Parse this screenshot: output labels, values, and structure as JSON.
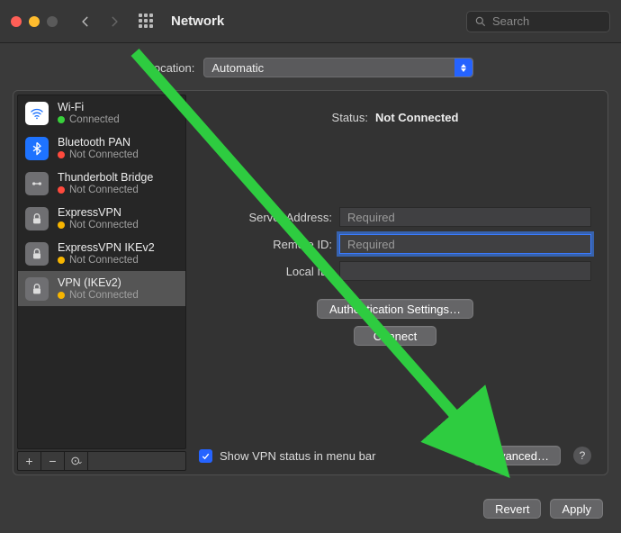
{
  "window": {
    "title": "Network",
    "search_placeholder": "Search"
  },
  "location": {
    "label": "Location:",
    "value": "Automatic"
  },
  "sidebar": {
    "items": [
      {
        "name": "Wi-Fi",
        "status": "Connected",
        "dot": "green",
        "icon": "wifi"
      },
      {
        "name": "Bluetooth PAN",
        "status": "Not Connected",
        "dot": "red",
        "icon": "bt"
      },
      {
        "name": "Thunderbolt Bridge",
        "status": "Not Connected",
        "dot": "red",
        "icon": "tb"
      },
      {
        "name": "ExpressVPN",
        "status": "Not Connected",
        "dot": "yellow",
        "icon": "vpn"
      },
      {
        "name": "ExpressVPN IKEv2",
        "status": "Not Connected",
        "dot": "yellow",
        "icon": "vpn"
      },
      {
        "name": "VPN (IKEv2)",
        "status": "Not Connected",
        "dot": "yellow",
        "icon": "vpn",
        "selected": true
      }
    ]
  },
  "detail": {
    "status_label": "Status:",
    "status_value": "Not Connected",
    "fields": {
      "server_address": {
        "label": "Server Address:",
        "placeholder": "Required",
        "value": ""
      },
      "remote_id": {
        "label": "Remote ID:",
        "placeholder": "Required",
        "value": "",
        "focused": true
      },
      "local_id": {
        "label": "Local ID:",
        "placeholder": "",
        "value": ""
      }
    },
    "buttons": {
      "auth": "Authentication Settings…",
      "connect": "Connect",
      "advanced": "Advanced…"
    },
    "checkbox": {
      "label": "Show VPN status in menu bar",
      "checked": true
    },
    "help": "?"
  },
  "footer": {
    "revert": "Revert",
    "apply": "Apply"
  }
}
